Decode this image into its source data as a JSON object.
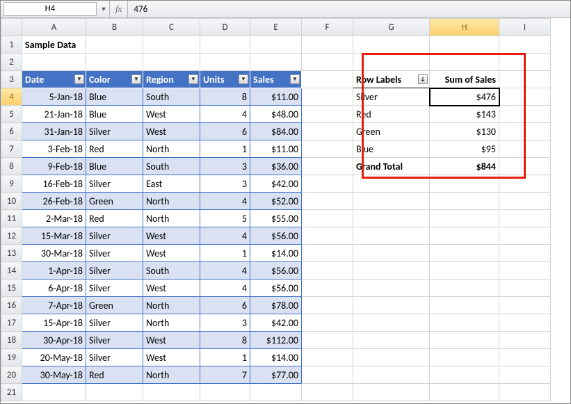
{
  "namebox": "H4",
  "fx_label": "fx",
  "formula": "476",
  "columns": [
    "A",
    "B",
    "C",
    "D",
    "E",
    "F",
    "G",
    "H",
    "I"
  ],
  "selected_col": "H",
  "selected_row": 4,
  "title_cell": "Sample Data",
  "headers": [
    "Date",
    "Color",
    "Region",
    "Units",
    "Sales"
  ],
  "rows": [
    {
      "n": 4,
      "date": "5-Jan-18",
      "color": "Blue",
      "region": "South",
      "units": "8",
      "sales": "$11.00"
    },
    {
      "n": 5,
      "date": "21-Jan-18",
      "color": "Blue",
      "region": "West",
      "units": "4",
      "sales": "$48.00"
    },
    {
      "n": 6,
      "date": "31-Jan-18",
      "color": "Silver",
      "region": "West",
      "units": "6",
      "sales": "$84.00"
    },
    {
      "n": 7,
      "date": "3-Feb-18",
      "color": "Red",
      "region": "North",
      "units": "1",
      "sales": "$11.00"
    },
    {
      "n": 8,
      "date": "9-Feb-18",
      "color": "Blue",
      "region": "South",
      "units": "3",
      "sales": "$36.00"
    },
    {
      "n": 9,
      "date": "16-Feb-18",
      "color": "Silver",
      "region": "East",
      "units": "3",
      "sales": "$42.00"
    },
    {
      "n": 10,
      "date": "26-Feb-18",
      "color": "Green",
      "region": "North",
      "units": "4",
      "sales": "$52.00"
    },
    {
      "n": 11,
      "date": "2-Mar-18",
      "color": "Red",
      "region": "North",
      "units": "5",
      "sales": "$55.00"
    },
    {
      "n": 12,
      "date": "15-Mar-18",
      "color": "Silver",
      "region": "West",
      "units": "4",
      "sales": "$56.00"
    },
    {
      "n": 13,
      "date": "30-Mar-18",
      "color": "Silver",
      "region": "West",
      "units": "1",
      "sales": "$14.00"
    },
    {
      "n": 14,
      "date": "1-Apr-18",
      "color": "Silver",
      "region": "South",
      "units": "4",
      "sales": "$56.00"
    },
    {
      "n": 15,
      "date": "6-Apr-18",
      "color": "Silver",
      "region": "West",
      "units": "4",
      "sales": "$56.00"
    },
    {
      "n": 16,
      "date": "7-Apr-18",
      "color": "Green",
      "region": "North",
      "units": "6",
      "sales": "$78.00"
    },
    {
      "n": 17,
      "date": "15-Apr-18",
      "color": "Silver",
      "region": "North",
      "units": "3",
      "sales": "$42.00"
    },
    {
      "n": 18,
      "date": "30-Apr-18",
      "color": "Silver",
      "region": "West",
      "units": "8",
      "sales": "$112.00"
    },
    {
      "n": 19,
      "date": "20-May-18",
      "color": "Silver",
      "region": "West",
      "units": "1",
      "sales": "$14.00"
    },
    {
      "n": 20,
      "date": "30-May-18",
      "color": "Red",
      "region": "North",
      "units": "7",
      "sales": "$77.00"
    }
  ],
  "pivot": {
    "hdr_labels": "Row Labels",
    "hdr_sum": "Sum of Sales",
    "rows": [
      {
        "label": "Silver",
        "val": "$476"
      },
      {
        "label": "Red",
        "val": "$143"
      },
      {
        "label": "Green",
        "val": "$130"
      },
      {
        "label": "Blue",
        "val": "$95"
      }
    ],
    "total_label": "Grand Total",
    "total_val": "$844"
  },
  "blank_rows": [
    21
  ]
}
